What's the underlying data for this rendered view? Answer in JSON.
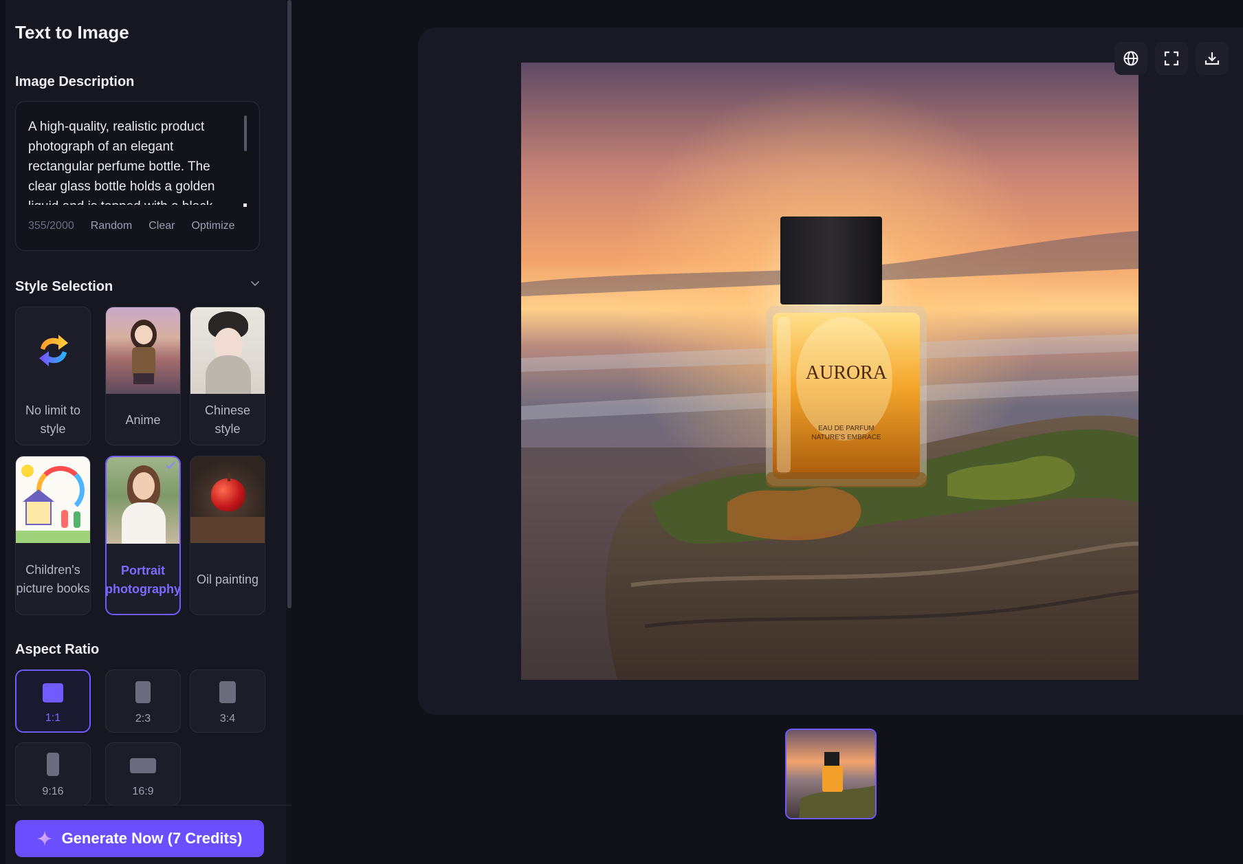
{
  "sidebar": {
    "title": "Text to Image",
    "description": {
      "label": "Image Description",
      "text": "A high-quality, realistic product photograph of an elegant rectangular perfume bottle. The clear glass bottle holds a golden liquid and is topped with a black",
      "char_count": "355/2000",
      "actions": {
        "random": "Random",
        "clear": "Clear",
        "optimize": "Optimize"
      }
    },
    "style": {
      "label": "Style Selection",
      "items": [
        {
          "label": "No limit to style",
          "icon": "refresh-arrows-icon",
          "selected": false
        },
        {
          "label": "Anime",
          "selected": false
        },
        {
          "label": "Chinese style",
          "selected": false
        },
        {
          "label": "Children's picture books",
          "selected": false
        },
        {
          "label": "Portrait photography",
          "selected": true
        },
        {
          "label": "Oil painting",
          "selected": false
        }
      ]
    },
    "aspect_ratio": {
      "label": "Aspect Ratio",
      "items": [
        {
          "label": "1:1",
          "selected": true
        },
        {
          "label": "2:3",
          "selected": false
        },
        {
          "label": "3:4",
          "selected": false
        },
        {
          "label": "9:16",
          "selected": false
        },
        {
          "label": "16:9",
          "selected": false
        }
      ]
    },
    "generate_button": "Generate Now (7 Credits)"
  },
  "preview": {
    "bottle_brand": "AURORA",
    "bottle_line1": "EAU DE PARFUM",
    "bottle_line2": "NATURE'S EMBRACE",
    "toolbar": [
      "globe-icon",
      "fullscreen-icon",
      "download-icon"
    ]
  },
  "colors": {
    "accent": "#6f5bff",
    "button": "#6b4fff",
    "background": "#101119",
    "panel": "#181924"
  }
}
